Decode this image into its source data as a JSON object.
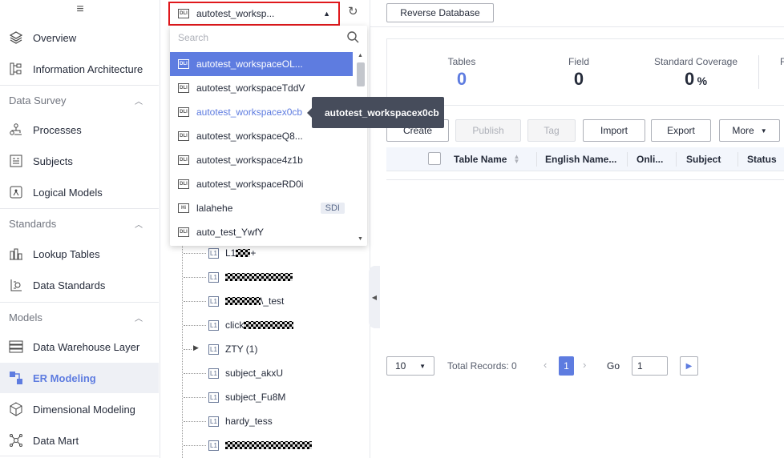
{
  "nav": {
    "items": [
      {
        "label": "Overview",
        "icon": "layers-icon"
      },
      {
        "label": "Information Architecture",
        "icon": "architecture-icon"
      },
      {
        "label": "Processes",
        "icon": "process-icon"
      },
      {
        "label": "Subjects",
        "icon": "subjects-icon"
      },
      {
        "label": "Logical Models",
        "icon": "logical-model-icon"
      },
      {
        "label": "Lookup Tables",
        "icon": "lookup-table-icon"
      },
      {
        "label": "Data Standards",
        "icon": "data-standard-icon"
      },
      {
        "label": "Data Warehouse Layer",
        "icon": "warehouse-icon"
      },
      {
        "label": "ER Modeling",
        "icon": "er-modeling-icon"
      },
      {
        "label": "Dimensional Modeling",
        "icon": "cube-icon"
      },
      {
        "label": "Data Mart",
        "icon": "data-mart-icon"
      }
    ],
    "groups": [
      "Data Survey",
      "Standards",
      "Models"
    ]
  },
  "workspace_select": {
    "value": "autotest_worksp...",
    "icon": "DLI"
  },
  "dropdown": {
    "search_placeholder": "Search",
    "items": [
      {
        "label": "autotest_workspaceOL...",
        "type": "DLI",
        "badge": ""
      },
      {
        "label": "autotest_workspaceTddV",
        "type": "DLI",
        "badge": ""
      },
      {
        "label": "autotest_workspacex0cb",
        "type": "DLI",
        "badge": ""
      },
      {
        "label": "autotest_workspaceQ8...",
        "type": "DLI",
        "badge": ""
      },
      {
        "label": "autotest_workspace4z1b",
        "type": "DLI",
        "badge": ""
      },
      {
        "label": "autotest_workspaceRD0i",
        "type": "DLI",
        "badge": ""
      },
      {
        "label": "lalahehe",
        "type": "Hi",
        "badge": "SDI"
      },
      {
        "label": "auto_test_YwfY",
        "type": "DLI",
        "badge": ""
      }
    ]
  },
  "tooltip": "autotest_workspacex0cb",
  "tree": {
    "nodes": [
      {
        "label": "L1",
        "suffix": "+"
      },
      {
        "label": "",
        "suffix": ""
      },
      {
        "label": "",
        "suffix": "\\_test"
      },
      {
        "label": "click",
        "suffix": ""
      },
      {
        "label": "ZTY (1)",
        "suffix": ""
      },
      {
        "label": "subject_akxU",
        "suffix": ""
      },
      {
        "label": "subject_Fu8M",
        "suffix": ""
      },
      {
        "label": "hardy_tess",
        "suffix": ""
      },
      {
        "label": "",
        "suffix": ""
      }
    ],
    "node_badge": "L1"
  },
  "toolbar": {
    "reverse": "Reverse Database",
    "create": "Create",
    "publish": "Publish",
    "tag": "Tag",
    "import": "Import",
    "export": "Export",
    "more": "More"
  },
  "stats": {
    "tables_label": "Tables",
    "tables_value": "0",
    "field_label": "Field",
    "field_value": "0",
    "coverage_label": "Standard Coverage",
    "coverage_value": "0",
    "coverage_unit": "%",
    "cut_label": "F"
  },
  "table": {
    "headers": [
      "Table Name",
      "English Name...",
      "Onli...",
      "Subject",
      "Status"
    ]
  },
  "pager": {
    "size": "10",
    "total": "Total Records: 0",
    "page": "1",
    "go_label": "Go",
    "go_value": "1"
  },
  "colors": {
    "accent": "#5e7ce0",
    "highlight_border": "#e0181c"
  }
}
